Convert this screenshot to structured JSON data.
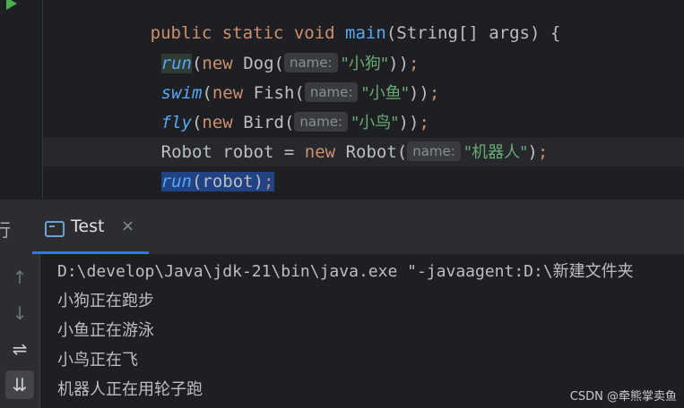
{
  "editor": {
    "line0": {
      "kw_public": "public",
      "kw_static": "static",
      "kw_void": "void",
      "method": "main",
      "rest": "(String[] args) {"
    },
    "line1": {
      "call": "run",
      "open": "(",
      "kw_new": "new",
      "cls": " Dog(",
      "hint": "name:",
      "str": "\"小狗\"",
      "close": "))",
      "semi": ";"
    },
    "line2": {
      "call": "swim",
      "open": "(",
      "kw_new": "new",
      "cls": " Fish(",
      "hint": "name:",
      "str": "\"小鱼\"",
      "close": "))",
      "semi": ";"
    },
    "line3": {
      "call": "fly",
      "open": "(",
      "kw_new": "new",
      "cls": " Bird(",
      "hint": "name:",
      "str": "\"小鸟\"",
      "close": "))",
      "semi": ";"
    },
    "line4": {
      "decl": "Robot robot = ",
      "kw_new": "new",
      "cls": " Robot(",
      "hint": "name:",
      "str": "\"机器人\"",
      "close": ")",
      "semi": ";"
    },
    "line5": {
      "call": "run",
      "args": "(robot)",
      "semi": ";"
    },
    "line6": {
      "brace": "}"
    }
  },
  "tool_window": {
    "cut_label": "行",
    "tab_label": "Test",
    "close_glyph": "×",
    "icons": [
      "arrow-up-icon",
      "arrow-down-icon",
      "soft-wrap-icon",
      "scroll-to-end-icon"
    ],
    "glyphs": {
      "up": "↑",
      "down": "↓",
      "wrap": "⇌",
      "scroll_end": "⇊"
    }
  },
  "console": {
    "command": "D:\\develop\\Java\\jdk-21\\bin\\java.exe \"-javaagent:D:\\新建文件夹",
    "lines": [
      "小狗正在跑步",
      "小鱼正在游泳",
      "小鸟正在飞",
      "机器人正在用轮子跑"
    ]
  },
  "watermark": "CSDN @牵熊掌卖鱼",
  "colors": {
    "editor_bg": "#1e1f22",
    "keyword": "#cf8e6d",
    "method": "#56a8f5",
    "string": "#6aab73",
    "selection": "#214283",
    "tab_underline": "#3574f0",
    "run_icon": "#4caf50"
  }
}
